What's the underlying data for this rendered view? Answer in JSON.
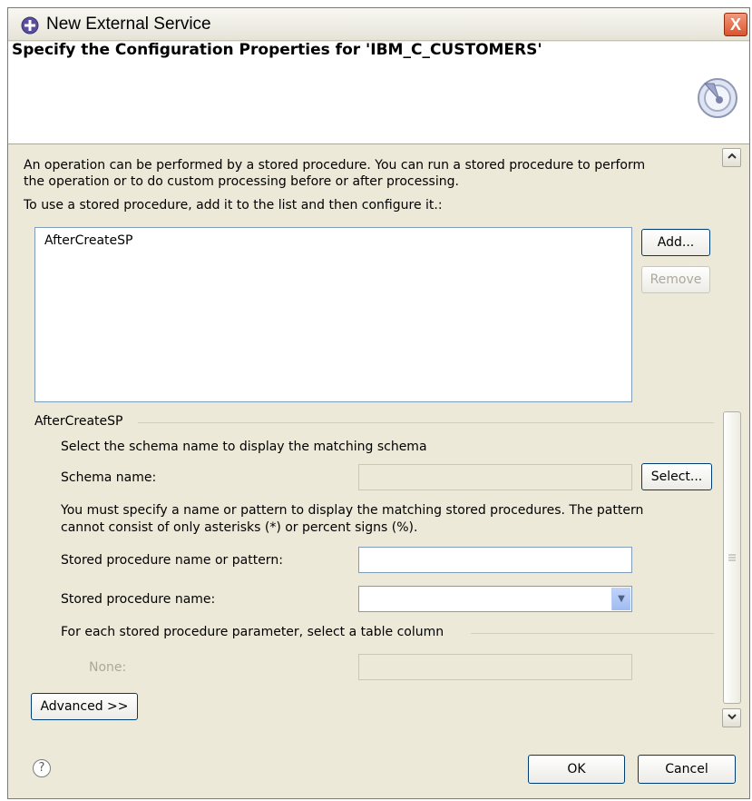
{
  "window": {
    "title": "New External Service",
    "close_label": "X"
  },
  "header": {
    "title": "Specify the Configuration Properties for 'IBM_C_CUSTOMERS'"
  },
  "intro": {
    "line1": "An operation can be performed by a stored procedure. You can run a stored procedure to perform",
    "line2": "the operation or to do custom processing before or after processing.",
    "instruction": "To use a stored procedure, add it to the list and then configure it.:"
  },
  "procedure_list": {
    "items": [
      "AfterCreateSP"
    ],
    "add_label": "Add...",
    "remove_label": "Remove"
  },
  "details": {
    "group_title": "AfterCreateSP",
    "schema_hint": "Select the schema name to display the matching schema",
    "schema_label": "Schema name:",
    "schema_value": "",
    "select_label": "Select...",
    "pattern_hint_line1": "You must specify a name or pattern to display the matching stored procedures. The pattern",
    "pattern_hint_line2": "cannot consist of only asterisks (*) or percent signs (%).",
    "pattern_label": "Stored procedure name or pattern:",
    "pattern_value": "",
    "name_label": "Stored procedure name:",
    "name_value": "",
    "param_group_title": "For each stored procedure parameter, select a table column",
    "none_label": "None:",
    "none_value": ""
  },
  "advanced_label": "Advanced >>",
  "footer": {
    "help_symbol": "?",
    "ok_label": "OK",
    "cancel_label": "Cancel"
  },
  "colors": {
    "dialog_bg": "#ece9d8",
    "close_button": "#d9542e",
    "field_border": "#7f9db9",
    "disabled_text": "#aca899"
  }
}
